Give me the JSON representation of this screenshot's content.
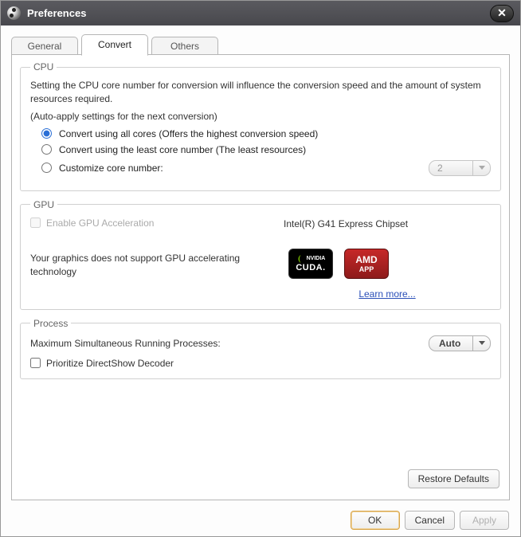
{
  "window": {
    "title": "Preferences"
  },
  "tabs": {
    "general": "General",
    "convert": "Convert",
    "others": "Others",
    "active": "convert"
  },
  "cpu": {
    "legend": "CPU",
    "description": "Setting the CPU core number for conversion will influence the conversion speed and the amount of system resources required.",
    "auto_note": "(Auto-apply settings for the next conversion)",
    "options": {
      "all_cores": "Convert using all cores (Offers the highest conversion speed)",
      "least_cores": "Convert using the least core number (The least resources)",
      "custom": "Customize core number:"
    },
    "selected": "all_cores",
    "custom_value": "2"
  },
  "gpu": {
    "legend": "GPU",
    "enable_label": "Enable GPU Acceleration",
    "enable_checked": false,
    "enable_enabled": false,
    "chipset": "Intel(R) G41 Express Chipset",
    "unsupported_note": "Your graphics does not support GPU accelerating technology",
    "logos": {
      "nvidia_top": "NVIDIA",
      "nvidia_bottom": "CUDA.",
      "amd_top": "AMD",
      "amd_bottom": "APP"
    },
    "learn_more": "Learn more..."
  },
  "process": {
    "legend": "Process",
    "max_label": "Maximum Simultaneous Running Processes:",
    "max_value": "Auto",
    "prioritize_label": "Prioritize DirectShow Decoder",
    "prioritize_checked": false
  },
  "buttons": {
    "restore": "Restore Defaults",
    "ok": "OK",
    "cancel": "Cancel",
    "apply": "Apply"
  }
}
